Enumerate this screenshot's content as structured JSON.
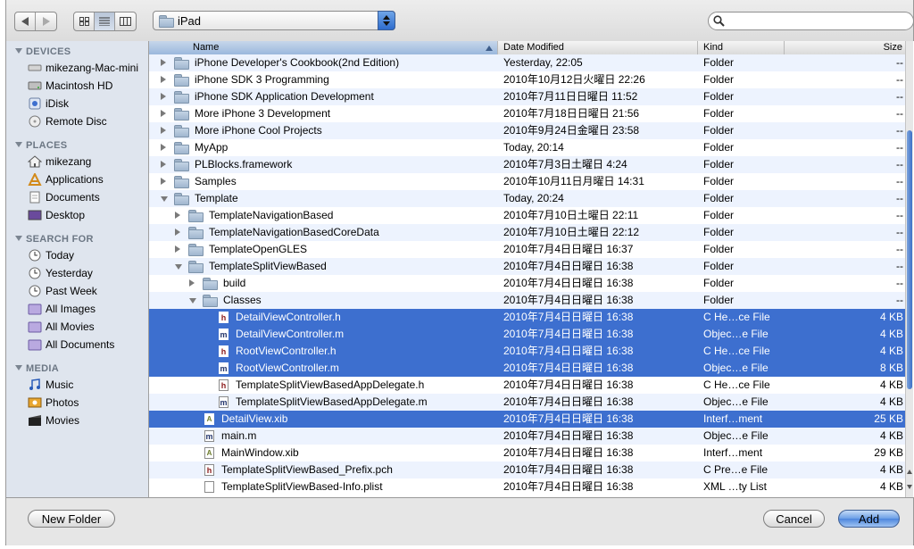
{
  "toolbar": {
    "back_icon": "back-arrow-icon",
    "forward_icon": "forward-arrow-icon",
    "location": "iPad",
    "search_placeholder": ""
  },
  "sidebar": {
    "devices_header": "DEVICES",
    "devices": [
      {
        "label": "mikezang-Mac-mini",
        "icon": "computer-icon"
      },
      {
        "label": "Macintosh HD",
        "icon": "hard-drive-icon"
      },
      {
        "label": "iDisk",
        "icon": "idisk-icon"
      },
      {
        "label": "Remote Disc",
        "icon": "remote-disc-icon"
      }
    ],
    "places_header": "PLACES",
    "places": [
      {
        "label": "mikezang",
        "icon": "home-icon"
      },
      {
        "label": "Applications",
        "icon": "applications-icon"
      },
      {
        "label": "Documents",
        "icon": "documents-icon"
      },
      {
        "label": "Desktop",
        "icon": "desktop-icon"
      }
    ],
    "search_header": "SEARCH FOR",
    "searches": [
      {
        "label": "Today",
        "icon": "clock-icon"
      },
      {
        "label": "Yesterday",
        "icon": "clock-icon"
      },
      {
        "label": "Past Week",
        "icon": "clock-icon"
      },
      {
        "label": "All Images",
        "icon": "smart-folder-icon"
      },
      {
        "label": "All Movies",
        "icon": "smart-folder-icon"
      },
      {
        "label": "All Documents",
        "icon": "smart-folder-icon"
      }
    ],
    "media_header": "MEDIA",
    "media": [
      {
        "label": "Music",
        "icon": "music-icon"
      },
      {
        "label": "Photos",
        "icon": "photos-icon"
      },
      {
        "label": "Movies",
        "icon": "movies-icon"
      }
    ]
  },
  "columns": {
    "name": "Name",
    "date": "Date Modified",
    "kind": "Kind",
    "size": "Size"
  },
  "rows": [
    {
      "name": "iPhone Developer's Cookbook(2nd Edition)",
      "date": "Yesterday, 22:05",
      "kind": "Folder",
      "size": "--",
      "type": "folder",
      "depth": 0,
      "disc": "r",
      "selected": false
    },
    {
      "name": "iPhone SDK 3 Programming",
      "date": "2010年10月12日火曜日 22:26",
      "kind": "Folder",
      "size": "--",
      "type": "folder",
      "depth": 0,
      "disc": "r",
      "selected": false
    },
    {
      "name": "iPhone SDK Application Development",
      "date": "2010年7月11日日曜日 11:52",
      "kind": "Folder",
      "size": "--",
      "type": "folder",
      "depth": 0,
      "disc": "r",
      "selected": false
    },
    {
      "name": "More iPhone 3 Development",
      "date": "2010年7月18日日曜日 21:56",
      "kind": "Folder",
      "size": "--",
      "type": "folder",
      "depth": 0,
      "disc": "r",
      "selected": false
    },
    {
      "name": "More iPhone Cool Projects",
      "date": "2010年9月24日金曜日 23:58",
      "kind": "Folder",
      "size": "--",
      "type": "folder",
      "depth": 0,
      "disc": "r",
      "selected": false
    },
    {
      "name": "MyApp",
      "date": "Today, 20:14",
      "kind": "Folder",
      "size": "--",
      "type": "folder",
      "depth": 0,
      "disc": "r",
      "selected": false
    },
    {
      "name": "PLBlocks.framework",
      "date": "2010年7月3日土曜日 4:24",
      "kind": "Folder",
      "size": "--",
      "type": "folder",
      "depth": 0,
      "disc": "r",
      "selected": false
    },
    {
      "name": "Samples",
      "date": "2010年10月11日月曜日 14:31",
      "kind": "Folder",
      "size": "--",
      "type": "folder",
      "depth": 0,
      "disc": "r",
      "selected": false
    },
    {
      "name": "Template",
      "date": "Today, 20:24",
      "kind": "Folder",
      "size": "--",
      "type": "folder",
      "depth": 0,
      "disc": "d",
      "selected": false
    },
    {
      "name": "TemplateNavigationBased",
      "date": "2010年7月10日土曜日 22:11",
      "kind": "Folder",
      "size": "--",
      "type": "folder",
      "depth": 1,
      "disc": "r",
      "selected": false
    },
    {
      "name": "TemplateNavigationBasedCoreData",
      "date": "2010年7月10日土曜日 22:12",
      "kind": "Folder",
      "size": "--",
      "type": "folder",
      "depth": 1,
      "disc": "r",
      "selected": false
    },
    {
      "name": "TemplateOpenGLES",
      "date": "2010年7月4日日曜日 16:37",
      "kind": "Folder",
      "size": "--",
      "type": "folder",
      "depth": 1,
      "disc": "r",
      "selected": false
    },
    {
      "name": "TemplateSplitViewBased",
      "date": "2010年7月4日日曜日 16:38",
      "kind": "Folder",
      "size": "--",
      "type": "folder",
      "depth": 1,
      "disc": "d",
      "selected": false
    },
    {
      "name": "build",
      "date": "2010年7月4日日曜日 16:38",
      "kind": "Folder",
      "size": "--",
      "type": "folder",
      "depth": 2,
      "disc": "r",
      "selected": false
    },
    {
      "name": "Classes",
      "date": "2010年7月4日日曜日 16:38",
      "kind": "Folder",
      "size": "--",
      "type": "folder",
      "depth": 2,
      "disc": "d",
      "selected": false
    },
    {
      "name": "DetailViewController.h",
      "date": "2010年7月4日日曜日 16:38",
      "kind": "C He…ce File",
      "size": "4 KB",
      "type": "h",
      "depth": 3,
      "disc": "",
      "selected": true
    },
    {
      "name": "DetailViewController.m",
      "date": "2010年7月4日日曜日 16:38",
      "kind": "Objec…e File",
      "size": "4 KB",
      "type": "m",
      "depth": 3,
      "disc": "",
      "selected": true
    },
    {
      "name": "RootViewController.h",
      "date": "2010年7月4日日曜日 16:38",
      "kind": "C He…ce File",
      "size": "4 KB",
      "type": "h",
      "depth": 3,
      "disc": "",
      "selected": true
    },
    {
      "name": "RootViewController.m",
      "date": "2010年7月4日日曜日 16:38",
      "kind": "Objec…e File",
      "size": "8 KB",
      "type": "m",
      "depth": 3,
      "disc": "",
      "selected": true
    },
    {
      "name": "TemplateSplitViewBasedAppDelegate.h",
      "date": "2010年7月4日日曜日 16:38",
      "kind": "C He…ce File",
      "size": "4 KB",
      "type": "h",
      "depth": 3,
      "disc": "",
      "selected": false
    },
    {
      "name": "TemplateSplitViewBasedAppDelegate.m",
      "date": "2010年7月4日日曜日 16:38",
      "kind": "Objec…e File",
      "size": "4 KB",
      "type": "m",
      "depth": 3,
      "disc": "",
      "selected": false
    },
    {
      "name": "DetailView.xib",
      "date": "2010年7月4日日曜日 16:38",
      "kind": "Interf…ment",
      "size": "25 KB",
      "type": "xib",
      "depth": 2,
      "disc": "",
      "selected": true
    },
    {
      "name": "main.m",
      "date": "2010年7月4日日曜日 16:38",
      "kind": "Objec…e File",
      "size": "4 KB",
      "type": "m",
      "depth": 2,
      "disc": "",
      "selected": false
    },
    {
      "name": "MainWindow.xib",
      "date": "2010年7月4日日曜日 16:38",
      "kind": "Interf…ment",
      "size": "29 KB",
      "type": "xib",
      "depth": 2,
      "disc": "",
      "selected": false
    },
    {
      "name": "TemplateSplitViewBased_Prefix.pch",
      "date": "2010年7月4日日曜日 16:38",
      "kind": "C Pre…e File",
      "size": "4 KB",
      "type": "h",
      "depth": 2,
      "disc": "",
      "selected": false
    },
    {
      "name": "TemplateSplitViewBased-Info.plist",
      "date": "2010年7月4日日曜日 16:38",
      "kind": "XML …ty List",
      "size": "4 KB",
      "type": "plist",
      "depth": 2,
      "disc": "",
      "selected": false
    }
  ],
  "buttons": {
    "new_folder": "New Folder",
    "cancel": "Cancel",
    "add": "Add"
  },
  "colors": {
    "selection": "#3d6fcf",
    "sidebar_bg": "#dfe5ee",
    "alt_row": "#edf3fe"
  }
}
